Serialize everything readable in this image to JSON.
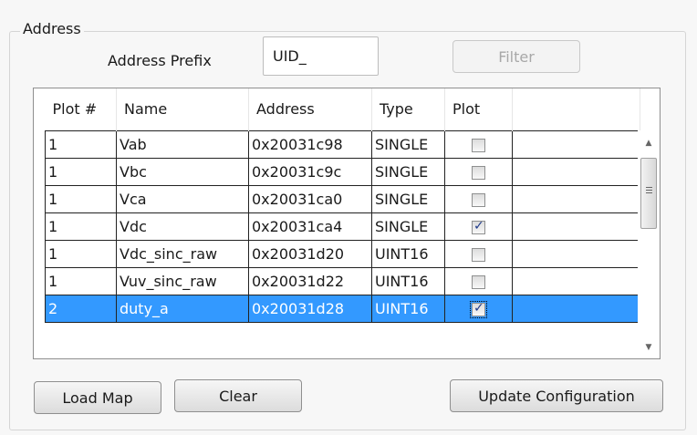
{
  "group": {
    "title": "Address"
  },
  "filter_bar": {
    "prefix_label": "Address Prefix",
    "prefix_value": "UID_",
    "filter_label": "Filter"
  },
  "grid": {
    "columns": [
      "Plot #",
      "Name",
      "Address",
      "Type",
      "Plot"
    ],
    "rows": [
      {
        "plot_num": "1",
        "name": "Vab",
        "address": "0x20031c98",
        "type": "SINGLE",
        "plot": false
      },
      {
        "plot_num": "1",
        "name": "Vbc",
        "address": "0x20031c9c",
        "type": "SINGLE",
        "plot": false
      },
      {
        "plot_num": "1",
        "name": "Vca",
        "address": "0x20031ca0",
        "type": "SINGLE",
        "plot": false
      },
      {
        "plot_num": "1",
        "name": "Vdc",
        "address": "0x20031ca4",
        "type": "SINGLE",
        "plot": true
      },
      {
        "plot_num": "1",
        "name": "Vdc_sinc_raw",
        "address": "0x20031d20",
        "type": "UINT16",
        "plot": false
      },
      {
        "plot_num": "1",
        "name": "Vuv_sinc_raw",
        "address": "0x20031d22",
        "type": "UINT16",
        "plot": false
      },
      {
        "plot_num": "2",
        "name": "duty_a",
        "address": "0x20031d28",
        "type": "UINT16",
        "plot": true
      }
    ],
    "selected_row": 6
  },
  "buttons": {
    "load_map": "Load Map",
    "clear": "Clear",
    "update_configuration": "Update Configuration"
  },
  "icons": {
    "scroll_up": "scroll-up-arrow-icon",
    "scroll_down": "scroll-down-arrow-icon",
    "checkbox": "checkbox-icon"
  },
  "colors": {
    "selection": "#3399ff",
    "check_mark": "#1f3a8a"
  }
}
